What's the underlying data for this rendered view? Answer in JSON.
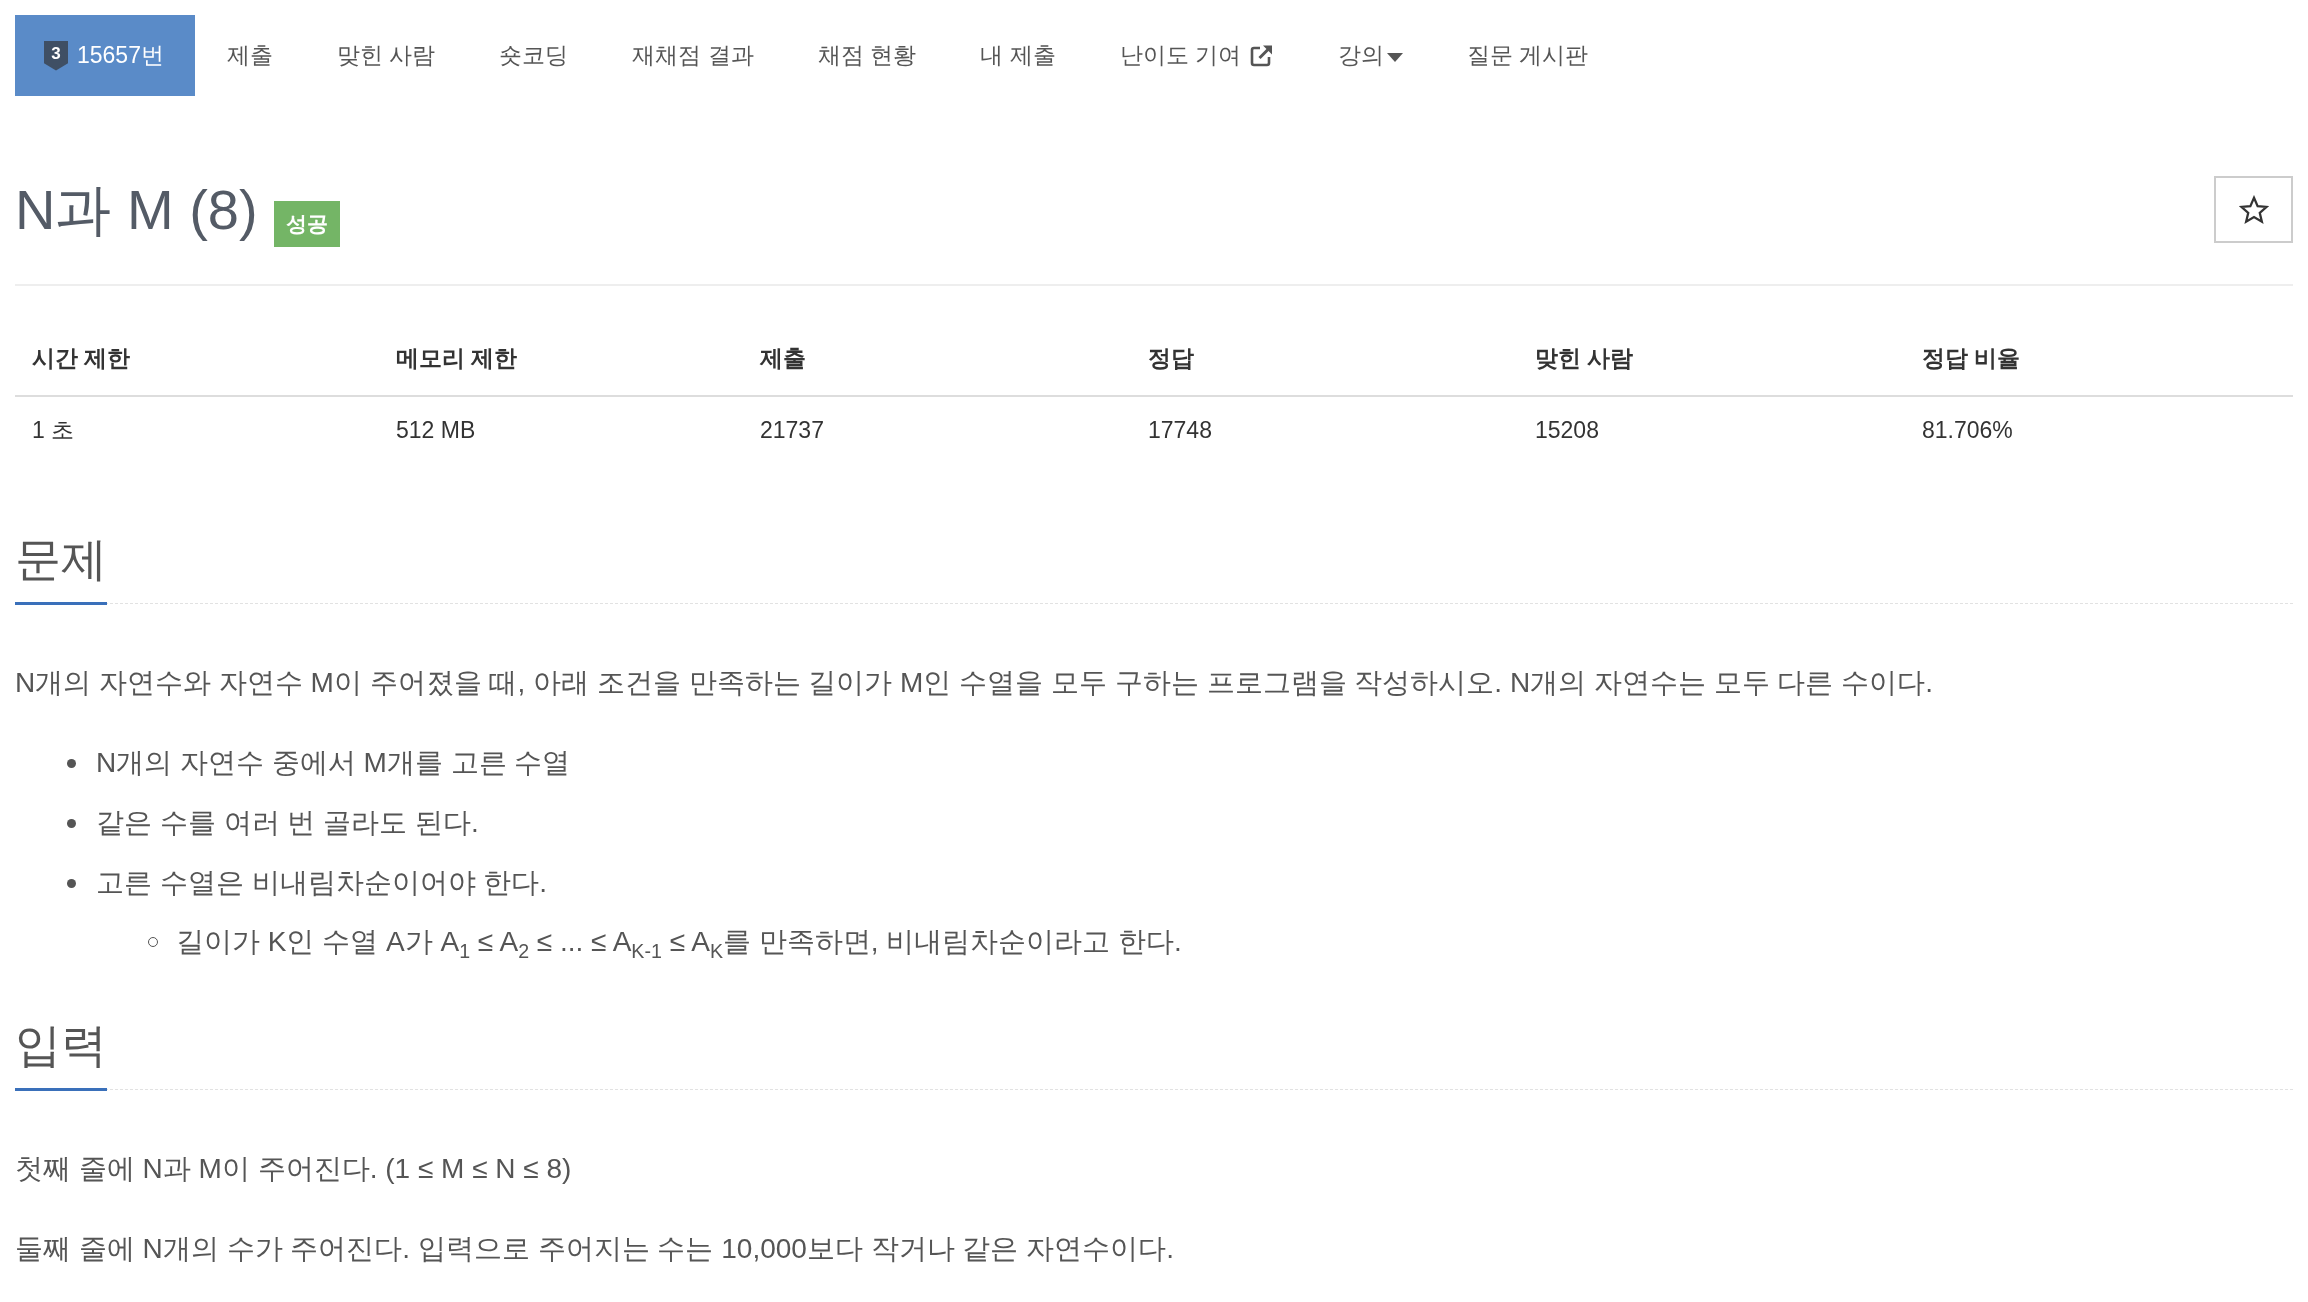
{
  "nav": {
    "tabs": [
      {
        "label": "15657번",
        "badge": "3",
        "kind": "plain",
        "selected": true
      },
      {
        "label": "제출",
        "kind": "plain",
        "selected": false
      },
      {
        "label": "맞힌 사람",
        "kind": "plain",
        "selected": false
      },
      {
        "label": "숏코딩",
        "kind": "plain",
        "selected": false
      },
      {
        "label": "재채점 결과",
        "kind": "plain",
        "selected": false
      },
      {
        "label": "채점 현황",
        "kind": "plain",
        "selected": false
      },
      {
        "label": "내 제출",
        "kind": "plain",
        "selected": false
      },
      {
        "label": "난이도 기여",
        "kind": "external",
        "selected": false
      },
      {
        "label": "강의",
        "kind": "dropdown",
        "selected": false
      },
      {
        "label": "질문 게시판",
        "kind": "plain",
        "selected": false
      }
    ]
  },
  "problem": {
    "title": "N과 M (8)",
    "status": "성공",
    "starred": false
  },
  "stats": {
    "columns": [
      "시간 제한",
      "메모리 제한",
      "제출",
      "정답",
      "맞힌 사람",
      "정답 비율"
    ],
    "rows": [
      [
        "1 초",
        "512 MB",
        "21737",
        "17748",
        "15208",
        "81.706%"
      ]
    ]
  },
  "sections": [
    {
      "heading": "문제",
      "blocks": [
        {
          "kind": "paragraph",
          "text": "N개의 자연수와 자연수 M이 주어졌을 때, 아래 조건을 만족하는 길이가 M인 수열을 모두 구하는 프로그램을 작성하시오. N개의 자연수는 모두 다른 수이다."
        },
        {
          "kind": "list",
          "items": [
            {
              "text": "N개의 자연수 중에서 M개를 고른 수열"
            },
            {
              "text": "같은 수를 여러 번 골라도 된다."
            },
            {
              "text": "고른 수열은 비내림차순이어야 한다.",
              "children": [
                {
                  "text": "길이가 K인 수열 A가 A$_{1}$ ≤ A$_{2}$ ≤ ... ≤ A$_{K-1}$ ≤ A$_{K}$를 만족하면, 비내림차순이라고 한다."
                }
              ]
            }
          ]
        }
      ]
    },
    {
      "heading": "입력",
      "blocks": [
        {
          "kind": "paragraph",
          "text": "첫째 줄에 N과 M이 주어진다. (1 ≤ M ≤ N ≤ 8)"
        },
        {
          "kind": "paragraph",
          "text": "둘째 줄에 N개의 수가 주어진다. 입력으로 주어지는 수는 10,000보다 작거나 같은 자연수이다."
        }
      ]
    }
  ]
}
